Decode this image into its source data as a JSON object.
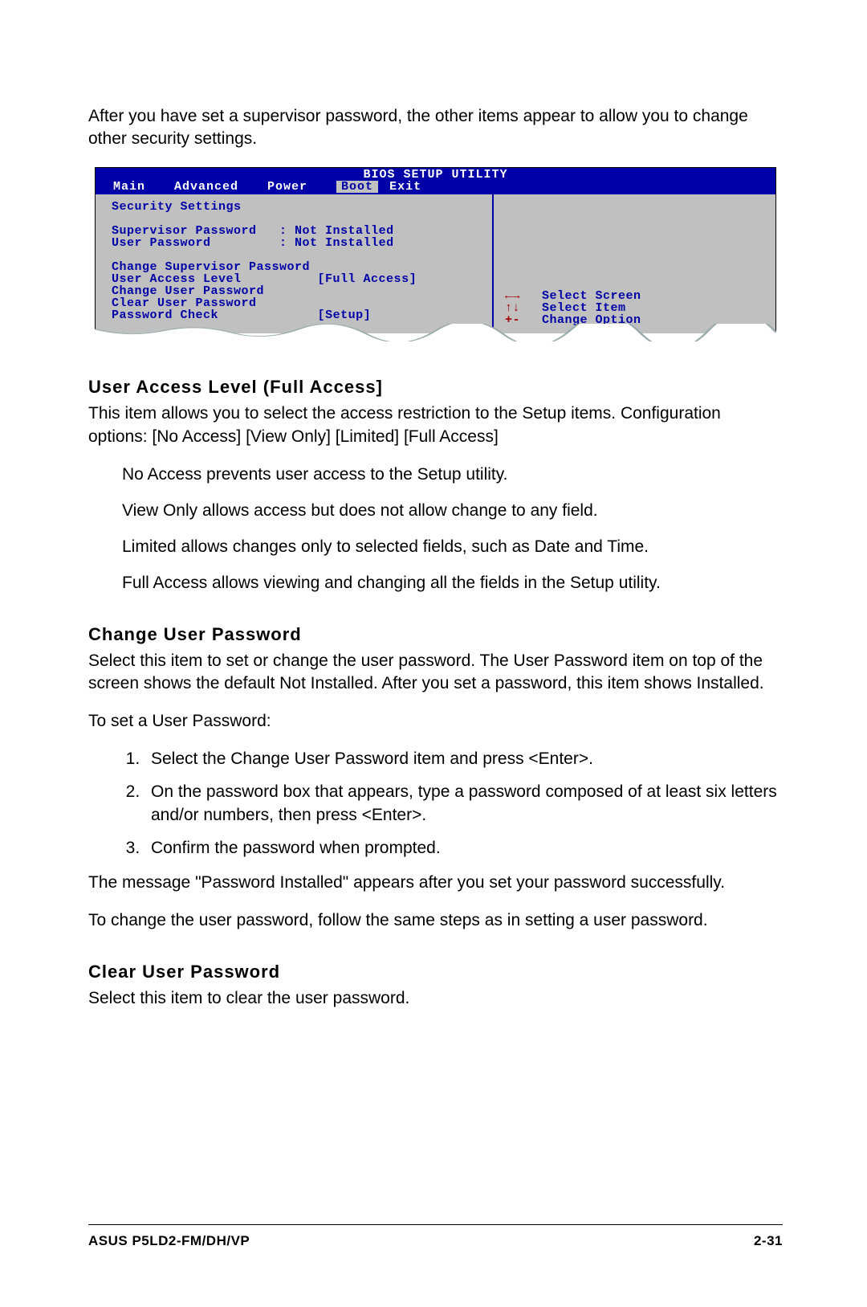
{
  "intro": "After you have set a supervisor password, the other items appear to allow you to change other security settings.",
  "bios": {
    "title": "BIOS SETUP UTILITY",
    "tabs": [
      "Main",
      "Advanced",
      "Power",
      "Boot",
      "Exit"
    ],
    "active_tab": "Boot",
    "section_title": "Security Settings",
    "supervisor_label": "Supervisor Password",
    "supervisor_value": ": Not Installed",
    "user_label": "User Password",
    "user_value": ": Not Installed",
    "change_supervisor": "Change Supervisor Password",
    "access_level_label": "User Access Level",
    "access_level_value": "[Full Access]",
    "change_user": "Change User Password",
    "clear_user": "Clear User Password",
    "pw_check_label": "Password Check",
    "pw_check_value": "[Setup]",
    "legend": {
      "screen_sym": "←→",
      "screen_txt": "Select Screen",
      "item_sym": "↑↓",
      "item_txt": "Select Item",
      "opt_sym": "+-",
      "opt_txt": "Change Option"
    }
  },
  "s1": {
    "heading": "User Access Level (Full Access]",
    "p1": "This item allows you to select the access restriction to the Setup items. Configuration options: [No Access] [View Only] [Limited] [Full Access]",
    "b1": "No Access prevents user access to the Setup utility.",
    "b2": "View Only allows access but does not allow change to any field.",
    "b3": "Limited allows changes only to selected fields, such as Date and Time.",
    "b4": "Full Access allows viewing and changing all the fields in the Setup utility."
  },
  "s2": {
    "heading": "Change User Password",
    "p1": "Select this item to set or change the user password. The User Password item on top of the screen shows the default Not Installed. After you set a password, this item shows Installed.",
    "p2": "To set a User Password:",
    "step1": "Select the Change User Password item and press <Enter>.",
    "step2": "On the password box that appears, type a password composed of at least six letters and/or numbers, then press <Enter>.",
    "step3": "Confirm the password when prompted.",
    "p3": "The message \"Password Installed\" appears after you set your password successfully.",
    "p4": "To change the user password, follow the same steps as in setting a user password."
  },
  "s3": {
    "heading": "Clear User Password",
    "p1": "Select this item to clear the user password."
  },
  "footer": {
    "left": "ASUS P5LD2-FM/DH/VP",
    "right": "2-31"
  }
}
